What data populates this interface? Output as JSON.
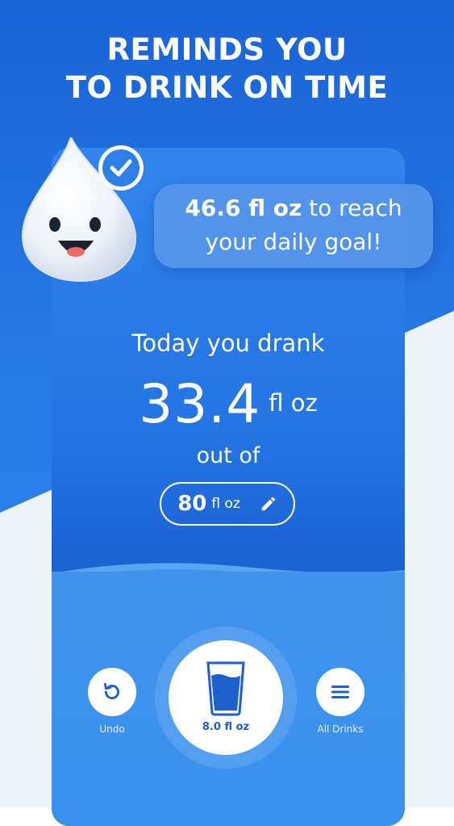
{
  "headline": {
    "line1": "REMINDS YOU",
    "line2": "TO DRINK ON TIME"
  },
  "goal_bubble": {
    "amount": "46.6 fl oz",
    "text_after_amount": " to reach",
    "line2": "your daily goal!"
  },
  "stats": {
    "today_label": "Today you drank",
    "amount_value": "33.4",
    "amount_unit": "fl oz",
    "out_of_label": "out of",
    "goal_value": "80",
    "goal_unit": "fl oz"
  },
  "controls": {
    "undo_label": "Undo",
    "glass_label": "8.0 fl oz",
    "all_drinks_label": "All Drinks"
  },
  "icons": {
    "mascot": "water-drop-mascot-icon",
    "check": "check-badge-icon",
    "edit": "pencil-icon",
    "undo": "undo-icon",
    "glass": "water-glass-icon",
    "menu": "hamburger-menu-icon"
  },
  "colors": {
    "primary_blue": "#1b61d2",
    "light_blue": "#3a90ee",
    "accent_text": "#1c5fcd",
    "white": "#ffffff"
  },
  "progress": {
    "drank_fl_oz": 33.4,
    "goal_fl_oz": 80,
    "remaining_fl_oz": 46.6
  }
}
